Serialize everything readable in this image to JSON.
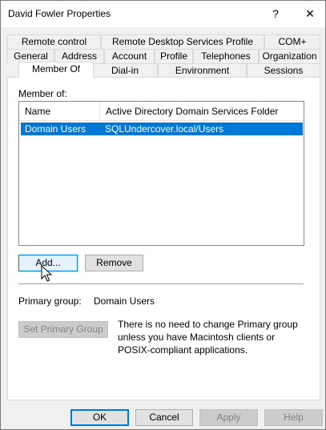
{
  "window": {
    "title": "David Fowler Properties",
    "help_glyph": "?",
    "close_glyph": "✕"
  },
  "tabs": {
    "row1": [
      "Remote control",
      "Remote Desktop Services Profile",
      "COM+"
    ],
    "row2": [
      "General",
      "Address",
      "Account",
      "Profile",
      "Telephones",
      "Organization"
    ],
    "row3": [
      "Member Of",
      "Dial-in",
      "Environment",
      "Sessions"
    ],
    "active": "Member Of"
  },
  "member_of": {
    "label": "Member of:",
    "columns": [
      "Name",
      "Active Directory Domain Services Folder"
    ],
    "rows": [
      {
        "name": "Domain Users",
        "folder": "SQLUndercover.local/Users",
        "selected": true
      }
    ]
  },
  "buttons": {
    "add": "Add...",
    "remove": "Remove",
    "set_primary_group": "Set Primary Group",
    "ok": "OK",
    "cancel": "Cancel",
    "apply": "Apply",
    "help": "Help"
  },
  "primary_group": {
    "label": "Primary group:",
    "value": "Domain Users",
    "note": "There is no need to change Primary group unless you have Macintosh clients or POSIX-compliant applications."
  },
  "colors": {
    "selection": "#0078d7",
    "dialog_bg": "#f0f0f0"
  }
}
